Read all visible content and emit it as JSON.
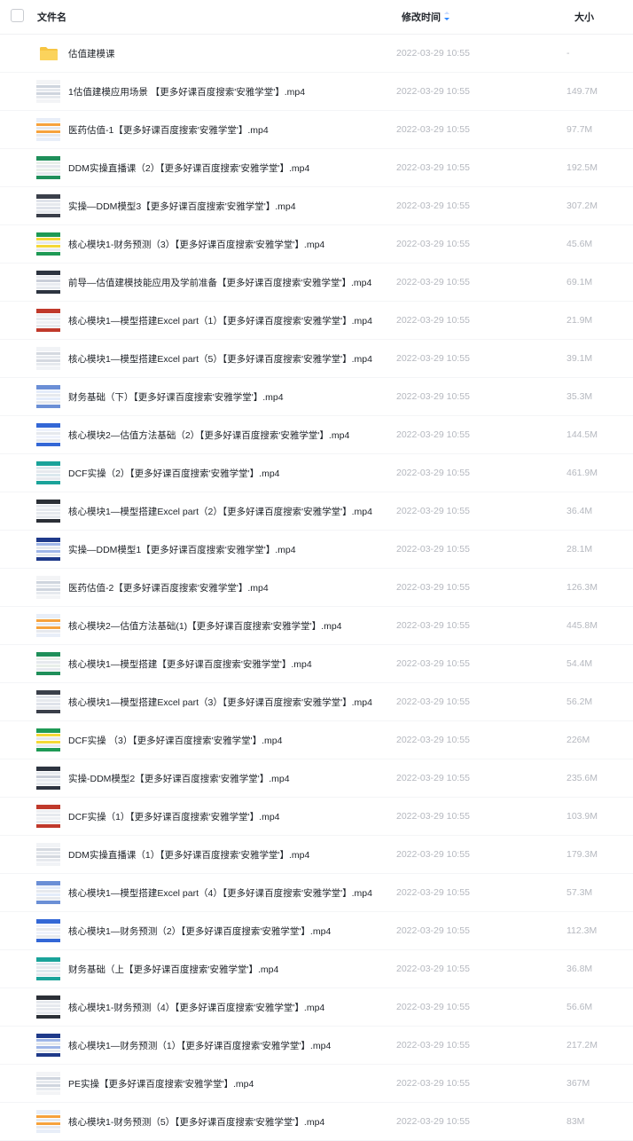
{
  "header": {
    "name_label": "文件名",
    "time_label": "修改时间",
    "size_label": "大小"
  },
  "colors": {
    "folder": "#f7c542",
    "sort_arrow": "#2f88ff",
    "muted_text": "#b5b8bf"
  },
  "files": [
    {
      "name": "估值建模课",
      "time": "2022-03-29 10:55",
      "size": "-",
      "icon": "folder-icon"
    },
    {
      "name": "1估值建模应用场景 【更多好课百度搜索'安雅学堂'】.mp4",
      "time": "2022-03-29 10:55",
      "size": "149.7M",
      "icon": "video-thumbnail"
    },
    {
      "name": "医药估值-1【更多好课百度搜索'安雅学堂'】.mp4",
      "time": "2022-03-29 10:55",
      "size": "97.7M",
      "icon": "video-thumbnail"
    },
    {
      "name": "DDM实操直播课（2）【更多好课百度搜索'安雅学堂'】.mp4",
      "time": "2022-03-29 10:55",
      "size": "192.5M",
      "icon": "video-thumbnail"
    },
    {
      "name": "实操—DDM模型3【更多好课百度搜索'安雅学堂'】.mp4",
      "time": "2022-03-29 10:55",
      "size": "307.2M",
      "icon": "video-thumbnail"
    },
    {
      "name": "核心模块1-财务预测（3）【更多好课百度搜索'安雅学堂'】.mp4",
      "time": "2022-03-29 10:55",
      "size": "45.6M",
      "icon": "video-thumbnail"
    },
    {
      "name": "前导—估值建模技能应用及学前准备【更多好课百度搜索'安雅学堂'】.mp4",
      "time": "2022-03-29 10:55",
      "size": "69.1M",
      "icon": "video-thumbnail"
    },
    {
      "name": "核心模块1—模型搭建Excel part（1）【更多好课百度搜索'安雅学堂'】.mp4",
      "time": "2022-03-29 10:55",
      "size": "21.9M",
      "icon": "video-thumbnail"
    },
    {
      "name": "核心模块1—模型搭建Excel part（5）【更多好课百度搜索'安雅学堂'】.mp4",
      "time": "2022-03-29 10:55",
      "size": "39.1M",
      "icon": "video-thumbnail"
    },
    {
      "name": "财务基础（下）【更多好课百度搜索'安雅学堂'】.mp4",
      "time": "2022-03-29 10:55",
      "size": "35.3M",
      "icon": "video-thumbnail"
    },
    {
      "name": "核心模块2—估值方法基础（2）【更多好课百度搜索'安雅学堂'】.mp4",
      "time": "2022-03-29 10:55",
      "size": "144.5M",
      "icon": "video-thumbnail"
    },
    {
      "name": "DCF实操（2）【更多好课百度搜索'安雅学堂'】.mp4",
      "time": "2022-03-29 10:55",
      "size": "461.9M",
      "icon": "video-thumbnail"
    },
    {
      "name": "核心模块1—模型搭建Excel part（2）【更多好课百度搜索'安雅学堂'】.mp4",
      "time": "2022-03-29 10:55",
      "size": "36.4M",
      "icon": "video-thumbnail"
    },
    {
      "name": "实操—DDM模型1【更多好课百度搜索'安雅学堂'】.mp4",
      "time": "2022-03-29 10:55",
      "size": "28.1M",
      "icon": "video-thumbnail"
    },
    {
      "name": "医药估值-2【更多好课百度搜索'安雅学堂'】.mp4",
      "time": "2022-03-29 10:55",
      "size": "126.3M",
      "icon": "video-thumbnail"
    },
    {
      "name": "核心模块2—估值方法基础(1)【更多好课百度搜索'安雅学堂'】.mp4",
      "time": "2022-03-29 10:55",
      "size": "445.8M",
      "icon": "video-thumbnail"
    },
    {
      "name": "核心模块1—模型搭建【更多好课百度搜索'安雅学堂'】.mp4",
      "time": "2022-03-29 10:55",
      "size": "54.4M",
      "icon": "video-thumbnail"
    },
    {
      "name": "核心模块1—模型搭建Excel part（3）【更多好课百度搜索'安雅学堂'】.mp4",
      "time": "2022-03-29 10:55",
      "size": "56.2M",
      "icon": "video-thumbnail"
    },
    {
      "name": "DCF实操 （3）【更多好课百度搜索'安雅学堂'】.mp4",
      "time": "2022-03-29 10:55",
      "size": "226M",
      "icon": "video-thumbnail"
    },
    {
      "name": "实操-DDM模型2【更多好课百度搜索'安雅学堂'】.mp4",
      "time": "2022-03-29 10:55",
      "size": "235.6M",
      "icon": "video-thumbnail"
    },
    {
      "name": "DCF实操（1）【更多好课百度搜索'安雅学堂'】.mp4",
      "time": "2022-03-29 10:55",
      "size": "103.9M",
      "icon": "video-thumbnail"
    },
    {
      "name": "DDM实操直播课（1）【更多好课百度搜索'安雅学堂'】.mp4",
      "time": "2022-03-29 10:55",
      "size": "179.3M",
      "icon": "video-thumbnail"
    },
    {
      "name": "核心模块1—模型搭建Excel part（4）【更多好课百度搜索'安雅学堂'】.mp4",
      "time": "2022-03-29 10:55",
      "size": "57.3M",
      "icon": "video-thumbnail"
    },
    {
      "name": "核心模块1—财务预测（2）【更多好课百度搜索'安雅学堂'】.mp4",
      "time": "2022-03-29 10:55",
      "size": "112.3M",
      "icon": "video-thumbnail"
    },
    {
      "name": "财务基础（上【更多好课百度搜索'安雅学堂'】.mp4",
      "time": "2022-03-29 10:55",
      "size": "36.8M",
      "icon": "video-thumbnail"
    },
    {
      "name": "核心模块1-财务预测（4）【更多好课百度搜索'安雅学堂'】.mp4",
      "time": "2022-03-29 10:55",
      "size": "56.6M",
      "icon": "video-thumbnail"
    },
    {
      "name": "核心模块1—财务预测（1）【更多好课百度搜索'安雅学堂'】.mp4",
      "time": "2022-03-29 10:55",
      "size": "217.2M",
      "icon": "video-thumbnail"
    },
    {
      "name": "PE实操【更多好课百度搜索'安雅学堂'】.mp4",
      "time": "2022-03-29 10:55",
      "size": "367M",
      "icon": "video-thumbnail"
    },
    {
      "name": "核心模块1-财务预测（5）【更多好课百度搜索'安雅学堂'】.mp4",
      "time": "2022-03-29 10:55",
      "size": "83M",
      "icon": "video-thumbnail"
    }
  ]
}
